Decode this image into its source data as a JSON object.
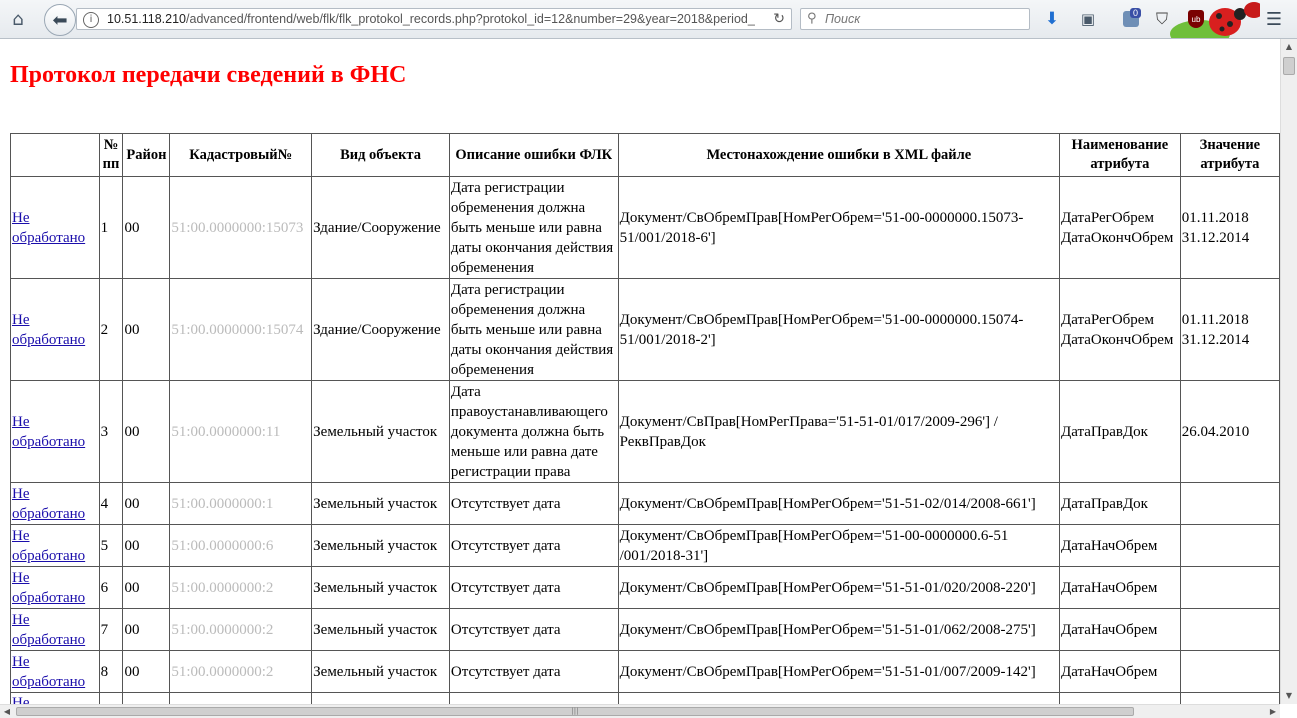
{
  "browser": {
    "url_host": "10.51.118.210",
    "url_path": "/advanced/frontend/web/flk/flk_protokol_records.php?protokol_id=12&number=29&year=2018&period_",
    "search_placeholder": "Поиск",
    "ext_badge_count": "0",
    "ublock_label": "ub",
    "icons": {
      "home": "home-icon",
      "back": "back-arrow-icon",
      "info": "info-icon",
      "reload": "reload-icon",
      "search": "search-icon",
      "download": "download-arrow-icon",
      "reader": "reader-view-icon",
      "pocket": "pocket-icon",
      "ublock": "ublock-shield-icon",
      "menu": "hamburger-menu-icon"
    }
  },
  "page": {
    "title": "Протокол передачи сведений в ФНС",
    "title_color": "#ff0000",
    "link_color": "#1a0dab"
  },
  "table": {
    "headers": {
      "status": "",
      "num": "№ пп",
      "district": "Район",
      "cadastral": "Кадастровый№",
      "object_type": "Вид объекта",
      "error_desc": "Описание ошибки ФЛК",
      "xml_location": "Местонахождение ошибки в XML файле",
      "attr_name": "Наименование атрибута",
      "attr_value": "Значение атрибута"
    },
    "rows": [
      {
        "status": "Не обработано",
        "num": "1",
        "district": "00",
        "cadastral": "51:00.0000000:15073",
        "object_type": "Здание/Сооружение",
        "error_desc": "Дата регистрации обременения должна быть меньше или равна даты окончания действия обременения",
        "xml_location": "Документ/СвОбремПрав[НомРегОбрем='51-00-0000000.15073-51/001/2018-6']",
        "attr_name": "ДатаРегОбрем ДатаОкончОбрем",
        "attr_value": "01.11.2018 31.12.2014"
      },
      {
        "status": "Не обработано",
        "num": "2",
        "district": "00",
        "cadastral": "51:00.0000000:15074",
        "object_type": "Здание/Сооружение",
        "error_desc": "Дата регистрации обременения должна быть меньше или равна даты окончания действия обременения",
        "xml_location": "Документ/СвОбремПрав[НомРегОбрем='51-00-0000000.15074-51/001/2018-2']",
        "attr_name": "ДатаРегОбрем ДатаОкончОбрем",
        "attr_value": "01.11.2018 31.12.2014"
      },
      {
        "status": "Не обработано",
        "num": "3",
        "district": "00",
        "cadastral": "51:00.0000000:11",
        "object_type": "Земельный участок",
        "error_desc": "Дата правоустанавливающего документа должна быть меньше или равна дате регистрации права",
        "xml_location": "Документ/СвПрав[НомРегПрава='51-51-01/017/2009-296'] /РеквПравДок",
        "attr_name": "ДатаПравДок",
        "attr_value": "26.04.2010"
      },
      {
        "status": "Не обработано",
        "num": "4",
        "district": "00",
        "cadastral": "51:00.0000000:1",
        "object_type": "Земельный участок",
        "error_desc": "Отсутствует дата",
        "xml_location": "Документ/СвОбремПрав[НомРегОбрем='51-51-02/014/2008-661']",
        "attr_name": "ДатаПравДок",
        "attr_value": ""
      },
      {
        "status": "Не обработано",
        "num": "5",
        "district": "00",
        "cadastral": "51:00.0000000:6",
        "object_type": "Земельный участок",
        "error_desc": "Отсутствует дата",
        "xml_location": "Документ/СвОбремПрав[НомРегОбрем='51-00-0000000.6-51 /001/2018-31']",
        "attr_name": "ДатаНачОбрем",
        "attr_value": ""
      },
      {
        "status": "Не обработано",
        "num": "6",
        "district": "00",
        "cadastral": "51:00.0000000:2",
        "object_type": "Земельный участок",
        "error_desc": "Отсутствует дата",
        "xml_location": "Документ/СвОбремПрав[НомРегОбрем='51-51-01/020/2008-220']",
        "attr_name": "ДатаНачОбрем",
        "attr_value": ""
      },
      {
        "status": "Не обработано",
        "num": "7",
        "district": "00",
        "cadastral": "51:00.0000000:2",
        "object_type": "Земельный участок",
        "error_desc": "Отсутствует дата",
        "xml_location": "Документ/СвОбремПрав[НомРегОбрем='51-51-01/062/2008-275']",
        "attr_name": "ДатаНачОбрем",
        "attr_value": ""
      },
      {
        "status": "Не обработано",
        "num": "8",
        "district": "00",
        "cadastral": "51:00.0000000:2",
        "object_type": "Земельный участок",
        "error_desc": "Отсутствует дата",
        "xml_location": "Документ/СвОбремПрав[НомРегОбрем='51-51-01/007/2009-142']",
        "attr_name": "ДатаНачОбрем",
        "attr_value": ""
      }
    ],
    "partial_row_status": "Не"
  }
}
